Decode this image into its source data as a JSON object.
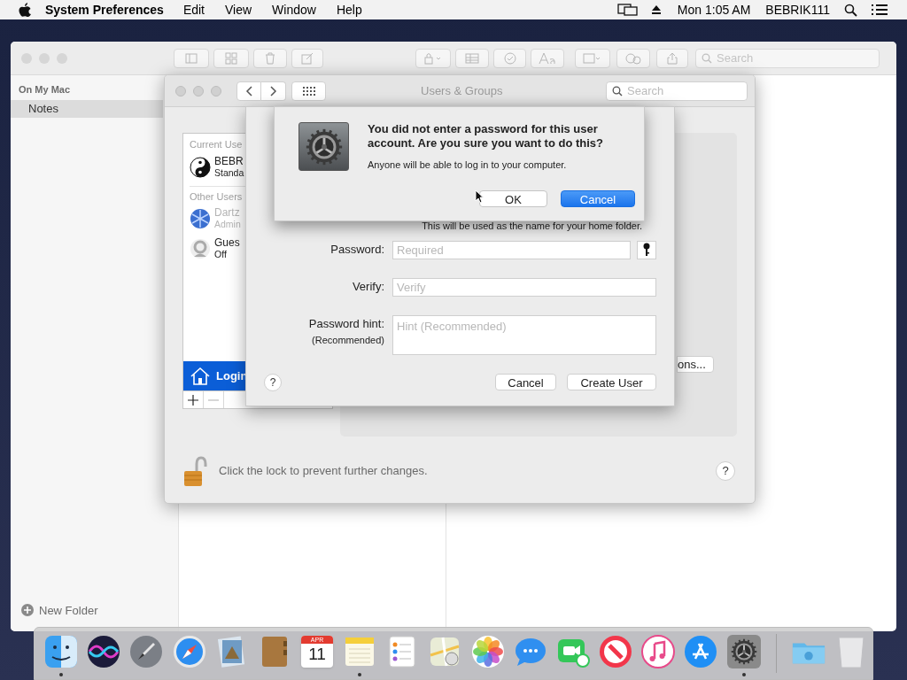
{
  "menu_bar": {
    "menus": [
      {
        "label": "System Preferences",
        "kind": "app"
      },
      {
        "label": "Edit",
        "kind": "menu"
      },
      {
        "label": "View",
        "kind": "menu"
      },
      {
        "label": "Window",
        "kind": "menu"
      },
      {
        "label": "Help",
        "kind": "menu"
      }
    ],
    "clock": "Mon 1:05 AM",
    "user": "BEBRIK111"
  },
  "notes_window": {
    "search": {
      "placeholder": "Search"
    },
    "sidebar": {
      "section": "On My Mac",
      "items": [
        {
          "label": "Notes",
          "selected": true
        }
      ]
    },
    "new_folder": "New Folder"
  },
  "users_window": {
    "title": "Users & Groups",
    "search": {
      "placeholder": "Search"
    },
    "users": [
      {
        "kind": "header",
        "label": "Current Use"
      },
      {
        "kind": "user",
        "name": "BEBR",
        "role": "Standa",
        "dimmed": false
      },
      {
        "kind": "header",
        "label": "Other Users"
      },
      {
        "kind": "user",
        "name": "Dartz",
        "role": "Admin",
        "dimmed": true
      },
      {
        "kind": "user",
        "name": "Gues",
        "role": "Off",
        "dimmed": false
      }
    ],
    "login_options": {
      "label": "Login",
      "selected": true
    },
    "partial_button": "ons...",
    "lock_text": "Click the lock to prevent further changes.",
    "locked": false
  },
  "sheet": {
    "home_hint": "This will be used as the name for your home folder.",
    "fields": [
      {
        "label": "Password:",
        "placeholder": "Required",
        "kind": "password"
      },
      {
        "label": "Verify:",
        "placeholder": "Verify",
        "kind": "text"
      },
      {
        "label": "Password hint:",
        "sublabel": "(Recommended)",
        "placeholder": "Hint (Recommended)",
        "kind": "area"
      }
    ],
    "help": "?",
    "buttons": [
      {
        "label": "Cancel",
        "default": false
      },
      {
        "label": "Create User",
        "default": false
      }
    ]
  },
  "alert": {
    "title": "You did not enter a password for this user account. Are you sure you want to do this?",
    "message": "Anyone will be able to log in to your computer.",
    "buttons": [
      {
        "label": "OK",
        "default": false
      },
      {
        "label": "Cancel",
        "default": true
      }
    ]
  },
  "dock": {
    "items": [
      {
        "kind": "finder",
        "running": true
      },
      {
        "kind": "siri",
        "running": false
      },
      {
        "kind": "launchpad",
        "running": false
      },
      {
        "kind": "safari",
        "running": false
      },
      {
        "kind": "preview",
        "running": false
      },
      {
        "kind": "contacts",
        "running": false
      },
      {
        "kind": "calendar",
        "running": false,
        "month": "APR",
        "day": "11"
      },
      {
        "kind": "notes",
        "running": true
      },
      {
        "kind": "reminders",
        "running": false
      },
      {
        "kind": "maps",
        "running": false
      },
      {
        "kind": "photos",
        "running": false
      },
      {
        "kind": "messages",
        "running": false
      },
      {
        "kind": "facetime",
        "running": false
      },
      {
        "kind": "news",
        "running": false
      },
      {
        "kind": "music",
        "running": false
      },
      {
        "kind": "appstore",
        "running": false
      },
      {
        "kind": "settings",
        "running": true
      },
      {
        "kind": "separator"
      },
      {
        "kind": "downloads",
        "running": false
      },
      {
        "kind": "trash",
        "running": false
      }
    ]
  }
}
